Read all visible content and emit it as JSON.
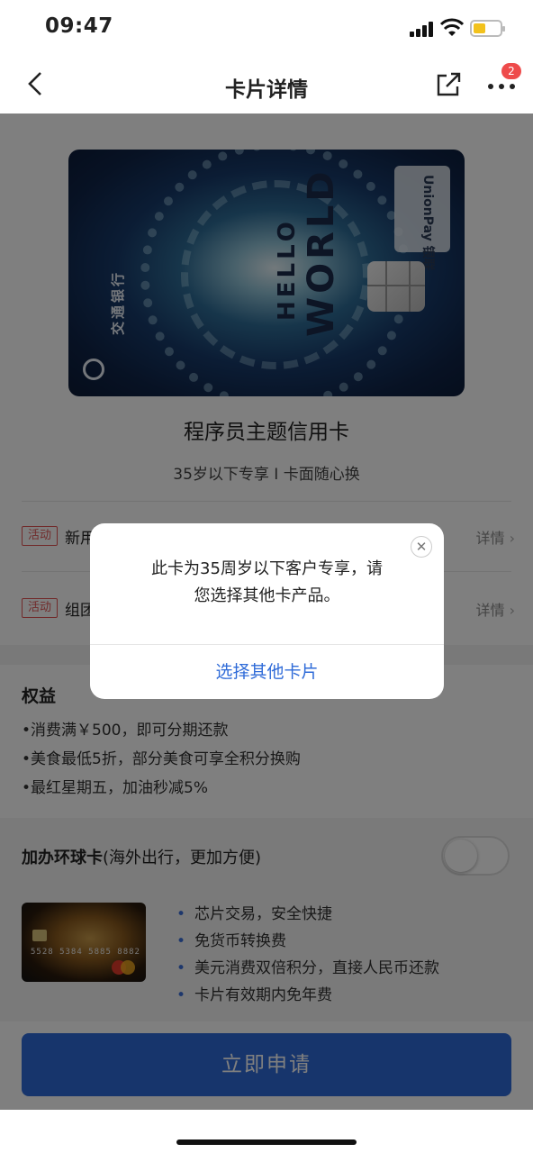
{
  "status_bar": {
    "time": "09:47"
  },
  "nav": {
    "title": "卡片详情",
    "badge_count": "2"
  },
  "card_art": {
    "hello": "HELLO",
    "world": "WORLD",
    "network": "UnionPay 银联",
    "bank": "交通银行"
  },
  "product": {
    "title": "程序员主题信用卡",
    "subtitle": "35岁以下专享 I 卡面随心换"
  },
  "promotions": [
    {
      "tag": "活动",
      "text": "新用",
      "detail": "详情"
    },
    {
      "tag": "活动",
      "text": "组团",
      "detail": "详情"
    }
  ],
  "benefits": {
    "title": "权益",
    "items": [
      "•消费满￥500，即可分期还款",
      "•美食最低5折，部分美食可享全积分换购",
      "•最红星期五，加油秒减5%"
    ]
  },
  "addon": {
    "title_bold": "加办环球卡",
    "title_rest": "(海外出行，更加方便)",
    "toggle_on": false,
    "card_number": "5528 5384 5885 8882",
    "features": [
      "芯片交易，安全快捷",
      "免货币转换费",
      "美元消费双倍积分，直接人民币还款",
      "卡片有效期内免年费"
    ]
  },
  "apply_button": "立即申请",
  "dialog": {
    "message_line1": "此卡为35周岁以下客户专享，请",
    "message_line2": "您选择其他卡产品。",
    "action": "选择其他卡片"
  },
  "colors": {
    "accent": "#2f6bd8",
    "tag_red": "#e25555",
    "badge": "#ee4b4b"
  }
}
